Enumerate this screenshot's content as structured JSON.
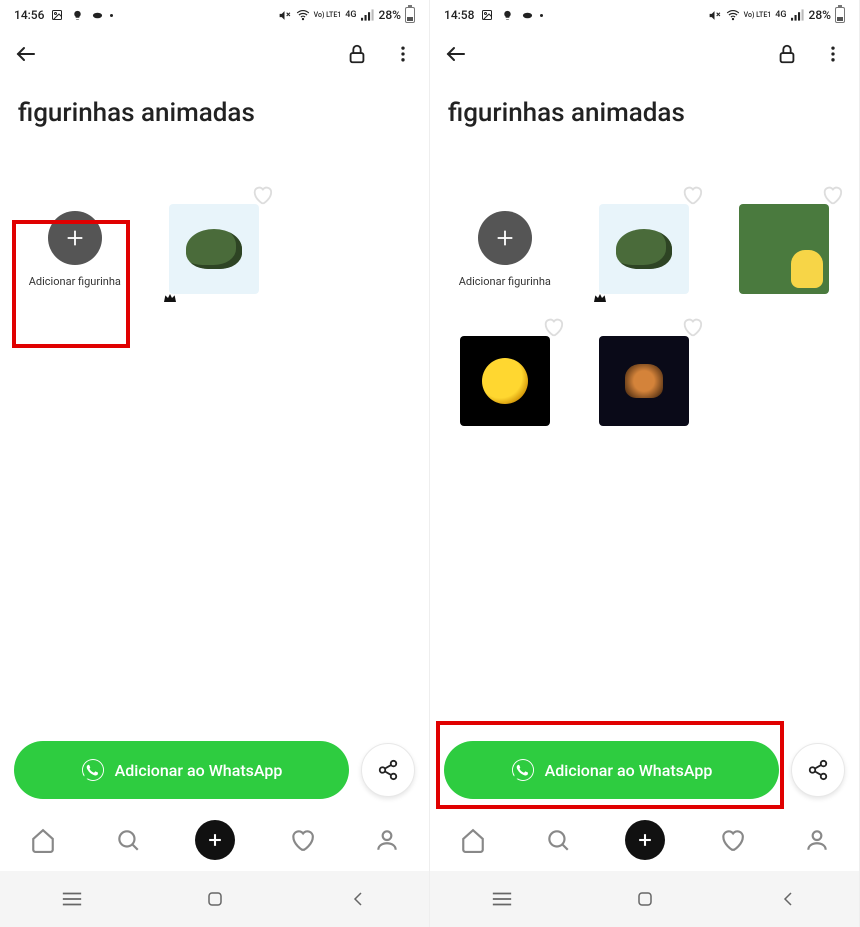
{
  "left": {
    "status": {
      "time": "14:56",
      "netlabel": "Vo) LTE1",
      "gen": "4G",
      "battery": "28%"
    },
    "title": "figurinhas animadas",
    "add_label": "Adicionar figurinha",
    "wa_label": "Adicionar ao WhatsApp"
  },
  "right": {
    "status": {
      "time": "14:58",
      "netlabel": "Vo) LTE1",
      "gen": "4G",
      "battery": "28%"
    },
    "title": "figurinhas animadas",
    "add_label": "Adicionar figurinha",
    "wa_label": "Adicionar ao WhatsApp"
  }
}
